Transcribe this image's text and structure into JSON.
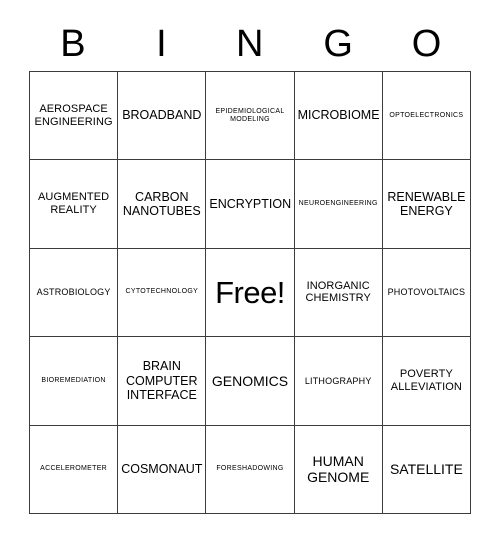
{
  "card": {
    "title": "BINGO",
    "header_letters": [
      "B",
      "I",
      "N",
      "G",
      "O"
    ],
    "free_space_label": "Free!",
    "grid_rows": 5,
    "grid_columns": 5,
    "background_color": "#ffffff",
    "border_color": "#3c3c3c",
    "text_color": "#000000",
    "cells": [
      [
        {
          "text": "AEROSPACE\nENGINEERING",
          "size": "sz-m",
          "free": false
        },
        {
          "text": "BROADBAND",
          "size": "sz-l",
          "free": false
        },
        {
          "text": "EPIDEMIOLOGICAL\nMODELING",
          "size": "sz-xs",
          "free": false
        },
        {
          "text": "MICROBIOME",
          "size": "sz-l",
          "free": false
        },
        {
          "text": "OPTOELECTRONICS",
          "size": "sz-xs",
          "free": false
        }
      ],
      [
        {
          "text": "AUGMENTED\nREALITY",
          "size": "sz-m",
          "free": false
        },
        {
          "text": "CARBON\nNANOTUBES",
          "size": "sz-l",
          "free": false
        },
        {
          "text": "ENCRYPTION",
          "size": "sz-l",
          "free": false
        },
        {
          "text": "NEUROENGINEERING",
          "size": "sz-xs",
          "free": false
        },
        {
          "text": "RENEWABLE\nENERGY",
          "size": "sz-l",
          "free": false
        }
      ],
      [
        {
          "text": "ASTROBIOLOGY",
          "size": "sz-s",
          "free": false
        },
        {
          "text": "CYTOTECHNOLOGY",
          "size": "sz-xs",
          "free": false
        },
        {
          "text": "Free!",
          "size": "sz-free",
          "free": true
        },
        {
          "text": "INORGANIC\nCHEMISTRY",
          "size": "sz-m",
          "free": false
        },
        {
          "text": "PHOTOVOLTAICS",
          "size": "sz-s",
          "free": false
        }
      ],
      [
        {
          "text": "BIOREMEDIATION",
          "size": "sz-xs",
          "free": false
        },
        {
          "text": "BRAIN\nCOMPUTER\nINTERFACE",
          "size": "sz-l",
          "free": false
        },
        {
          "text": "GENOMICS",
          "size": "sz-xl",
          "free": false
        },
        {
          "text": "LITHOGRAPHY",
          "size": "sz-s",
          "free": false
        },
        {
          "text": "POVERTY\nALLEVIATION",
          "size": "sz-m",
          "free": false
        }
      ],
      [
        {
          "text": "ACCELEROMETER",
          "size": "sz-xs",
          "free": false
        },
        {
          "text": "COSMONAUT",
          "size": "sz-l",
          "free": false
        },
        {
          "text": "FORESHADOWING",
          "size": "sz-xs",
          "free": false
        },
        {
          "text": "HUMAN\nGENOME",
          "size": "sz-xl",
          "free": false
        },
        {
          "text": "SATELLITE",
          "size": "sz-xl",
          "free": false
        }
      ]
    ]
  }
}
